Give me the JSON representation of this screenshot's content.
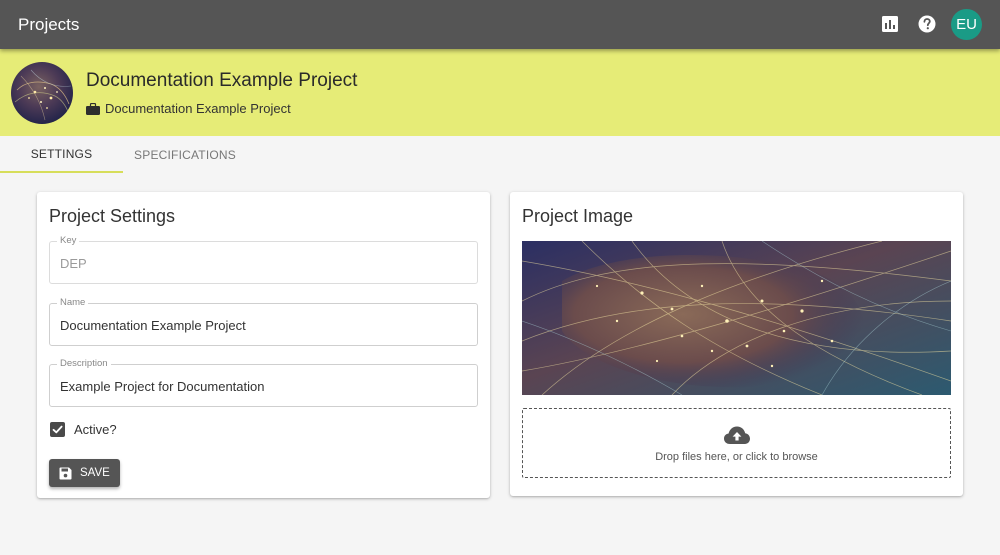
{
  "appbar": {
    "title": "Projects",
    "icons": [
      "analytics-icon",
      "help-icon"
    ],
    "user_initials": "EU",
    "color": "#555555",
    "avatar_color": "#1a9b86"
  },
  "project": {
    "name": "Documentation Example Project",
    "subtitle": "Documentation Example Project",
    "header_color": "#e6ec77"
  },
  "tabs": [
    {
      "label": "Settings",
      "active": true
    },
    {
      "label": "Specifications",
      "active": false
    }
  ],
  "settings": {
    "title": "Project Settings",
    "key": {
      "label": "Key",
      "value": "DEP",
      "disabled": true
    },
    "name": {
      "label": "Name",
      "value": "Documentation Example Project"
    },
    "description": {
      "label": "Description",
      "value": "Example Project for Documentation"
    },
    "active": {
      "label": "Active?",
      "checked": true
    },
    "save_label": "Save"
  },
  "image_panel": {
    "title": "Project Image",
    "dropzone_text": "Drop files here, or click to browse"
  }
}
